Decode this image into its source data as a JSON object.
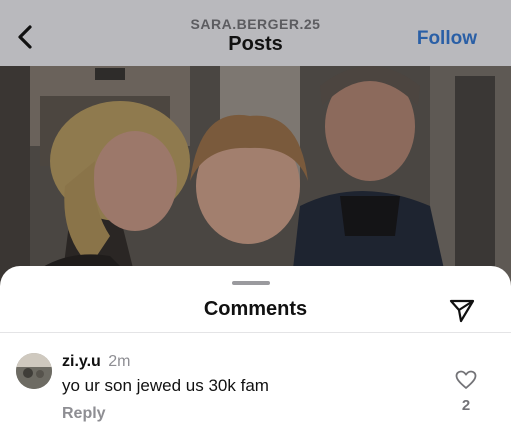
{
  "header": {
    "username": "SARA.BERGER.25",
    "title": "Posts",
    "follow_label": "Follow"
  },
  "comments_sheet": {
    "title": "Comments",
    "comments": [
      {
        "username": "zi.y.u",
        "time": "2m",
        "text": "yo ur son jewed us 30k fam",
        "reply_label": "Reply",
        "like_count": "2"
      }
    ]
  },
  "icons": {
    "back": "chevron-left-icon",
    "share": "paper-plane-icon",
    "like": "heart-outline-icon"
  }
}
